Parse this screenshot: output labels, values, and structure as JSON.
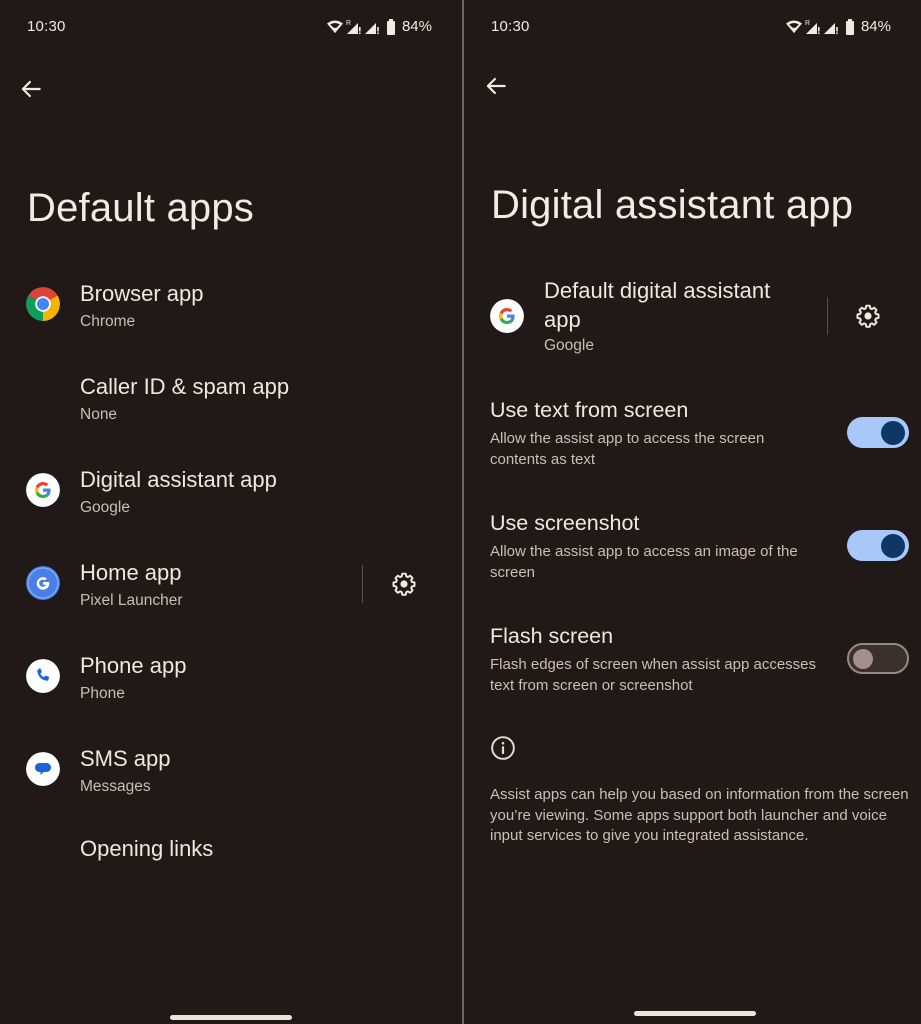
{
  "status_bar": {
    "time": "10:30",
    "battery": "84%",
    "icons": [
      "wifi-icon",
      "signal-roaming-icon",
      "signal-icon",
      "battery-icon"
    ],
    "roaming_label": "R"
  },
  "left_screen": {
    "back_icon": "arrow-back-icon",
    "title": "Default apps",
    "items": [
      {
        "title": "Browser app",
        "subtitle": "Chrome",
        "icon": "chrome-icon"
      },
      {
        "title": "Caller ID & spam app",
        "subtitle": "None",
        "icon": null
      },
      {
        "title": "Digital assistant app",
        "subtitle": "Google",
        "icon": "google-icon"
      },
      {
        "title": "Home app",
        "subtitle": "Pixel Launcher",
        "icon": "pixel-launcher-icon",
        "settings_icon": "gear-icon"
      },
      {
        "title": "Phone app",
        "subtitle": "Phone",
        "icon": "phone-icon"
      },
      {
        "title": "SMS app",
        "subtitle": "Messages",
        "icon": "messages-icon"
      },
      {
        "title": "Opening links",
        "subtitle": null,
        "icon": null
      }
    ]
  },
  "right_screen": {
    "back_icon": "arrow-back-icon",
    "title": "Digital assistant app",
    "default_app": {
      "title_line1": "Default digital assistant",
      "title_line2": "app",
      "subtitle": "Google",
      "icon": "google-icon",
      "settings_icon": "gear-icon"
    },
    "toggles": [
      {
        "title": "Use text from screen",
        "description": "Allow the assist app to access the screen contents as text",
        "enabled": true
      },
      {
        "title": "Use screenshot",
        "description": "Allow the assist app to access an image of the screen",
        "enabled": true
      },
      {
        "title": "Flash screen",
        "description": "Flash edges of screen when assist app accesses text from screen or screenshot",
        "enabled": false
      }
    ],
    "info_icon": "info-icon",
    "footer": "Assist apps can help you based on information from the screen you’re viewing. Some apps support both launcher and voice input services to give you integrated assistance."
  },
  "colors": {
    "background": "#211918",
    "toggle_on_track": "#A8C8FA",
    "toggle_on_knob": "#0E3768",
    "toggle_off_track": "#3A312F",
    "toggle_off_knob": "#A58F8B",
    "text_primary": "#F1E6E3",
    "text_secondary": "#C9BCB9"
  }
}
